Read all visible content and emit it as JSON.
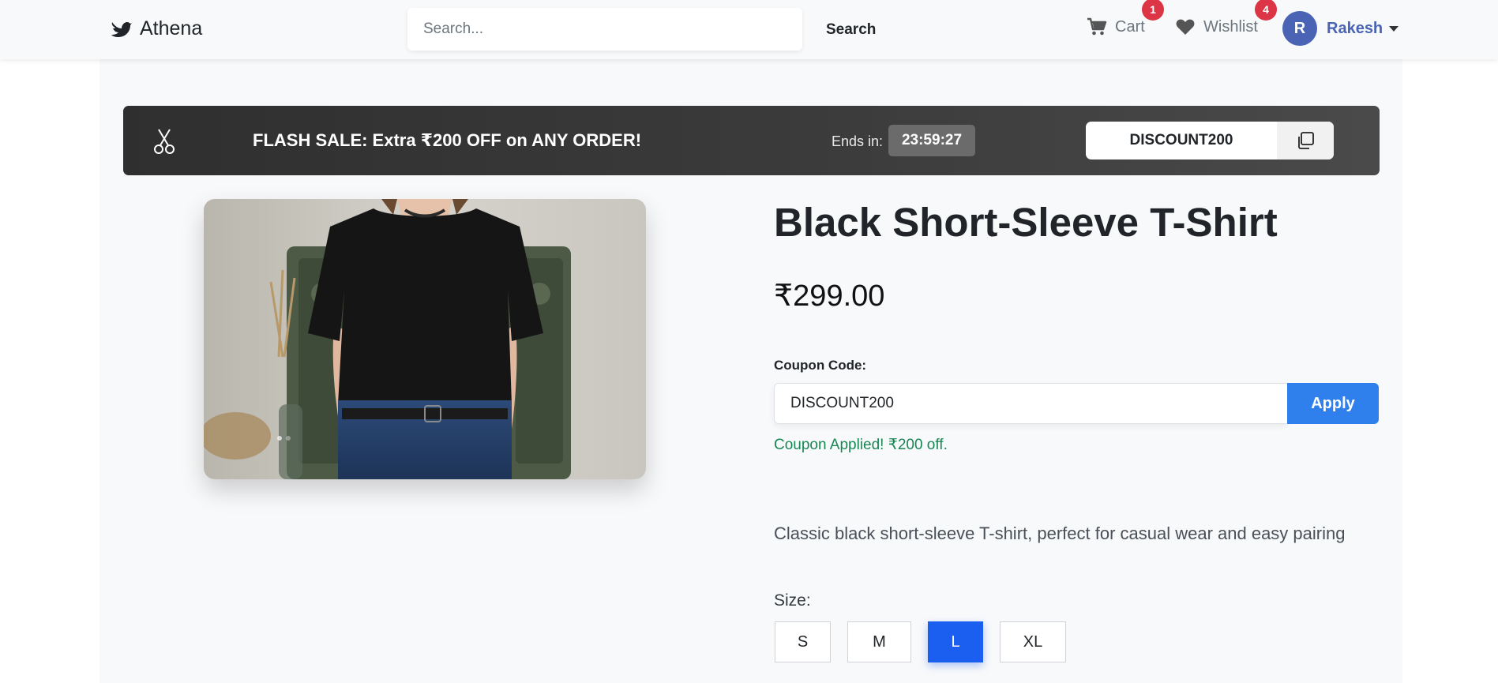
{
  "navbar": {
    "brand": "Athena",
    "search_placeholder": "Search...",
    "search_button": "Search",
    "cart_label": "Cart",
    "cart_count": "1",
    "wishlist_label": "Wishlist",
    "wishlist_count": "4",
    "user_initial": "R",
    "user_name": "Rakesh"
  },
  "flash_sale": {
    "text": "FLASH SALE: Extra ₹200 OFF on ANY ORDER!",
    "ends_label": "Ends in:",
    "timer": "23:59:27",
    "code": "DISCOUNT200"
  },
  "product": {
    "title": "Black Short-Sleeve T-Shirt",
    "price": "₹299.00",
    "coupon_label": "Coupon Code:",
    "coupon_value": "DISCOUNT200",
    "apply_button": "Apply",
    "coupon_message": "Coupon Applied! ₹200 off.",
    "description": "Classic black short-sleeve T-shirt, perfect for casual wear and easy pairing",
    "size_label": "Size:",
    "sizes": [
      "S",
      "M",
      "L",
      "XL"
    ],
    "selected_size": "L"
  },
  "colors": {
    "accent": "#2f80ed",
    "selected_size": "#1a5ff0",
    "badge": "#dc3545",
    "success": "#198754",
    "user": "#4a63b5"
  }
}
